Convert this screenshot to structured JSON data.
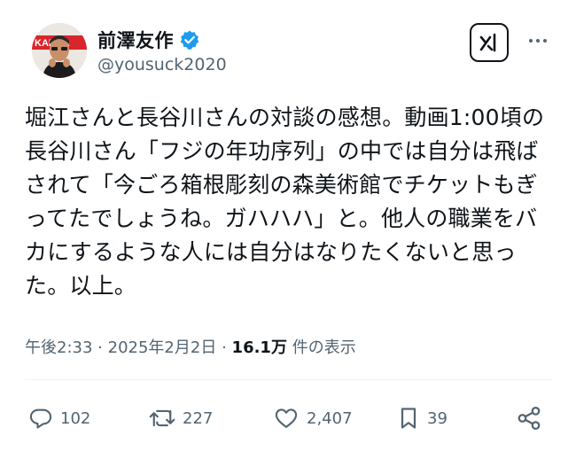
{
  "user": {
    "display_name": "前澤友作",
    "handle": "@yousuck2020",
    "verified": true,
    "avatar_badge": "KABU&"
  },
  "tweet": {
    "lines": [
      "堀江さんと長谷川さんの対談の感想。動画1:00頃の",
      "長谷川さん「フジの年功序列」の中では自分は飛ば",
      "されて「今ごろ箱根彫刻の森美術館でチケットもぎ",
      "ってたでしょうね。ガハハハ」と。他人の職業をバ",
      "カにするような人には自分はなりたくないと思っ",
      "た。以上。"
    ]
  },
  "meta": {
    "time": "午後2:33",
    "separator": "·",
    "date": "2025年2月2日",
    "views_count": "16.1万",
    "views_label": "件の表示"
  },
  "actions": {
    "replies": "102",
    "reposts": "227",
    "likes": "2,407",
    "bookmarks": "39"
  },
  "icons": {
    "grok": "grok-icon",
    "more": "more-icon",
    "reply": "reply-icon",
    "repost": "repost-icon",
    "like": "heart-icon",
    "bookmark": "bookmark-icon",
    "share": "share-icon",
    "verified": "verified-badge-icon"
  },
  "colors": {
    "verified": "#1d9bf0",
    "text": "#0f1419",
    "secondary": "#536471",
    "avatar_badge": "#d9262b"
  }
}
